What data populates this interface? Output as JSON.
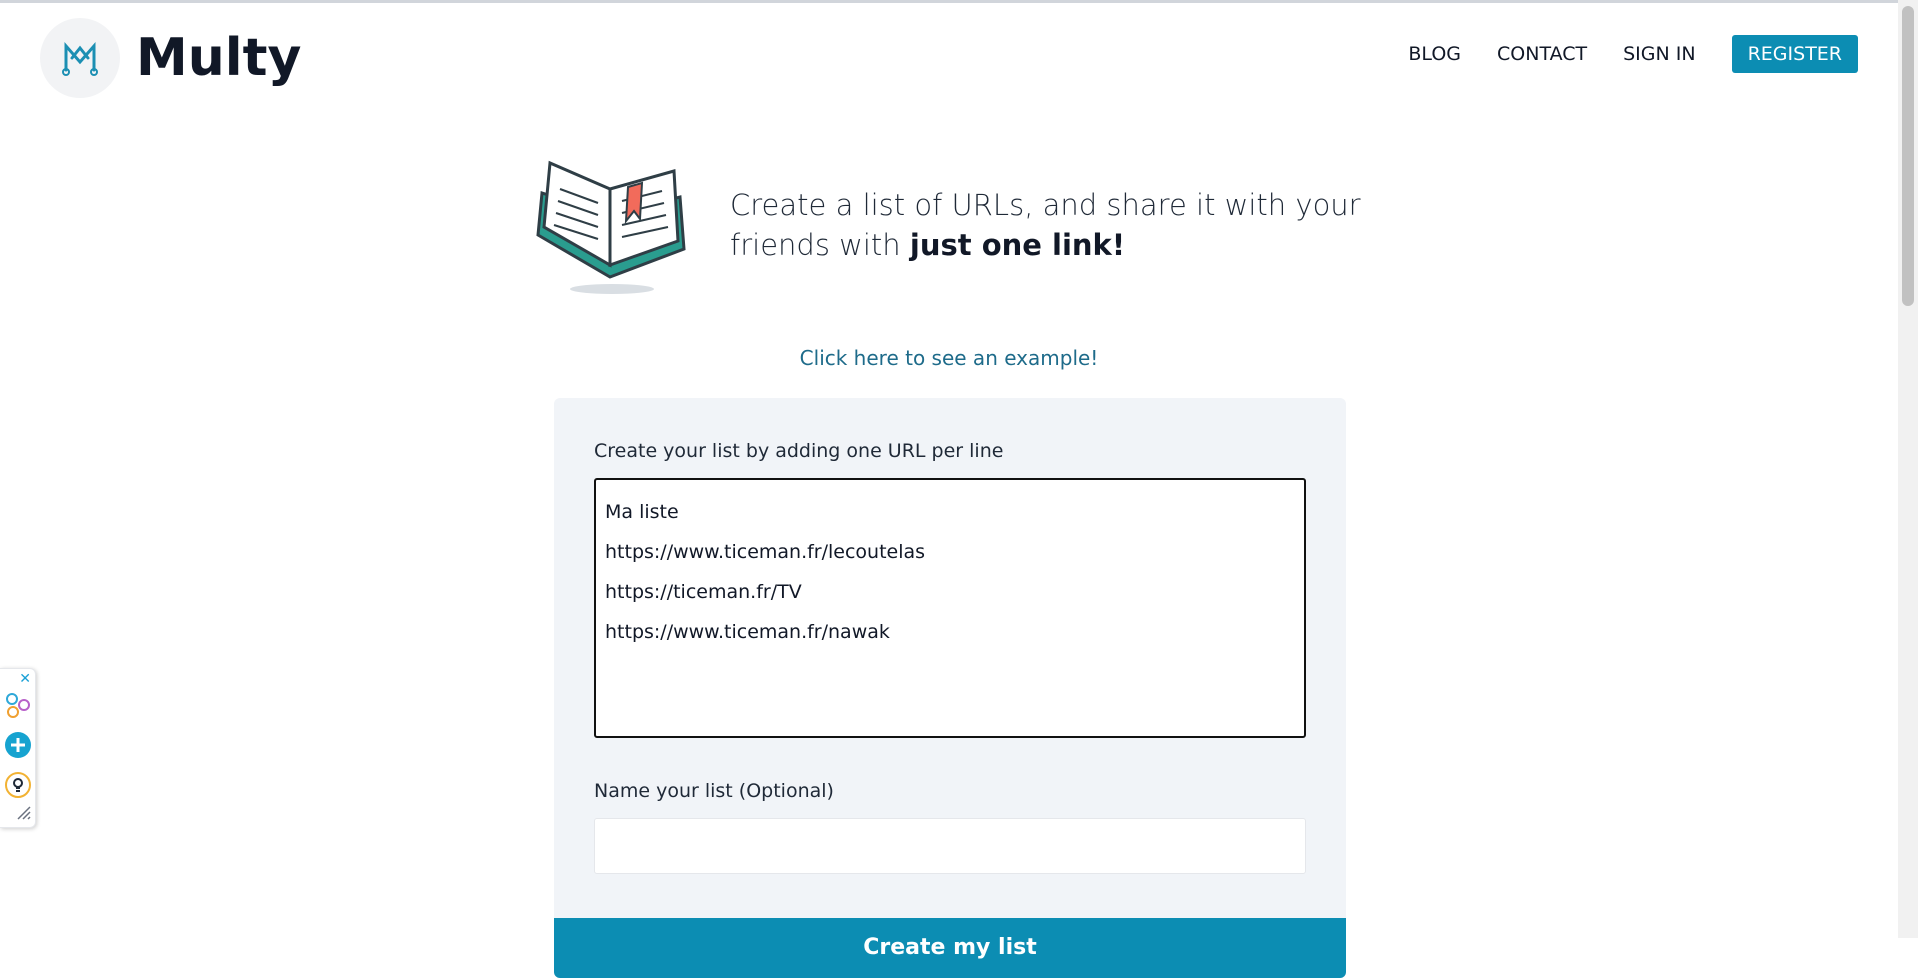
{
  "brand": {
    "name": "Multy",
    "logo_icon": "multy-logo-icon"
  },
  "nav": {
    "blog": "BLOG",
    "contact": "CONTACT",
    "sign_in": "SIGN IN",
    "register": "REGISTER"
  },
  "hero": {
    "text_regular": "Create a list of URLs, and share it with your friends with ",
    "text_bold": "just one link!",
    "illustration": "open-book-illustration"
  },
  "example_link": "Click here to see an example!",
  "form": {
    "urls_label": "Create your list by adding one URL per line",
    "urls_value": "Ma liste\nhttps://www.ticeman.fr/lecoutelas\nhttps://ticeman.fr/TV\nhttps://www.ticeman.fr/nawak",
    "name_label": "Name your list (Optional)",
    "name_value": "",
    "submit_label": "Create my list"
  },
  "colors": {
    "accent": "#0c8db3",
    "card_bg": "#f1f4f8",
    "link": "#1e6b8a"
  }
}
